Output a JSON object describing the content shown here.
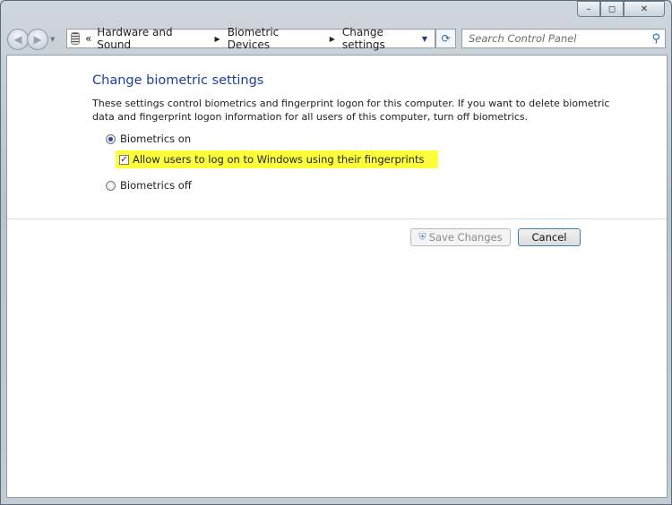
{
  "window": {
    "minimize": "–",
    "maximize": "◻",
    "close": "✕"
  },
  "nav": {
    "back": "◀",
    "forward": "▶",
    "recent": "▼"
  },
  "address": {
    "overflow": "«",
    "crumbs": [
      "Hardware and Sound",
      "Biometric Devices",
      "Change settings"
    ],
    "separator": "▶",
    "dropdown": "▼"
  },
  "refresh": "⟳",
  "search": {
    "placeholder": "Search Control Panel",
    "icon": "⚲"
  },
  "main": {
    "title": "Change biometric settings",
    "description": "These settings control biometrics and fingerprint logon for this computer. If you want to delete biometric data and fingerprint logon information for all users of this computer, turn off biometrics.",
    "biometrics_on": "Biometrics on",
    "allow_fingerprints": "Allow users to log on to Windows using their fingerprints",
    "allow_checked": "✓",
    "biometrics_off": "Biometrics off",
    "selected": "on",
    "highlight_color": "#ffff3a"
  },
  "buttons": {
    "save": "Save Changes",
    "cancel": "Cancel"
  }
}
